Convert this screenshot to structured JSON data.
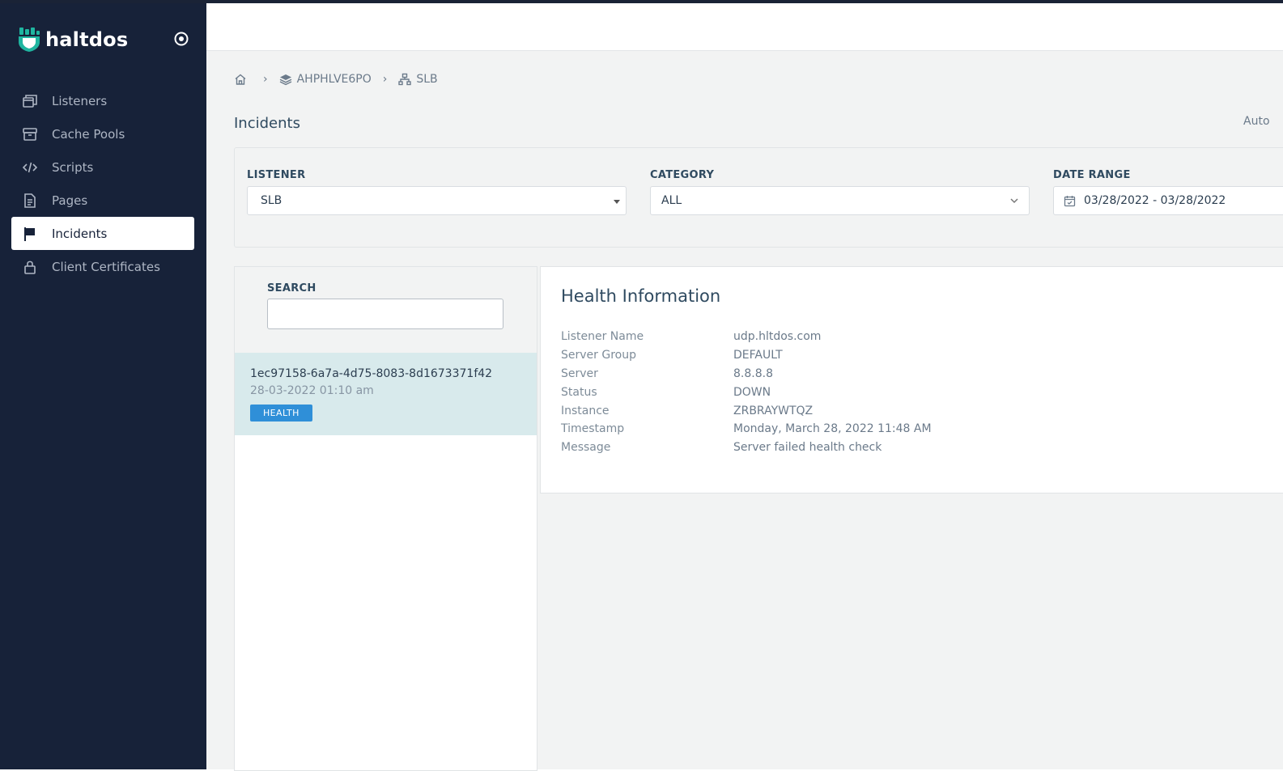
{
  "brand": {
    "name": "haltdos"
  },
  "sidebar": {
    "items": [
      {
        "label": "Listeners",
        "icon": "window-stack-icon",
        "active": false
      },
      {
        "label": "Cache Pools",
        "icon": "archive-box-icon",
        "active": false
      },
      {
        "label": "Scripts",
        "icon": "code-icon",
        "active": false
      },
      {
        "label": "Pages",
        "icon": "document-icon",
        "active": false
      },
      {
        "label": "Incidents",
        "icon": "flag-icon",
        "active": true
      },
      {
        "label": "Client Certificates",
        "icon": "lock-icon",
        "active": false
      }
    ]
  },
  "breadcrumb": {
    "home_icon": "home-icon",
    "items": [
      {
        "label": "AHPHLVE6PO",
        "icon": "layers-icon"
      },
      {
        "label": "SLB",
        "icon": "sitemap-icon"
      }
    ],
    "separator": "›"
  },
  "page": {
    "title": "Incidents",
    "auto_label": "Auto"
  },
  "filters": {
    "listener": {
      "label": "LISTENER",
      "value": "SLB"
    },
    "category": {
      "label": "CATEGORY",
      "value": "ALL"
    },
    "date_range": {
      "label": "DATE RANGE",
      "value": "03/28/2022 - 03/28/2022"
    }
  },
  "search": {
    "label": "SEARCH",
    "value": ""
  },
  "incidents": [
    {
      "id": "1ec97158-6a7a-4d75-8083-8d1673371f42",
      "time": "28-03-2022 01:10 am",
      "badge": "HEALTH"
    }
  ],
  "detail": {
    "title": "Health Information",
    "rows": [
      {
        "key": "Listener Name",
        "value": "udp.hltdos.com"
      },
      {
        "key": "Server Group",
        "value": "DEFAULT"
      },
      {
        "key": "Server",
        "value": "8.8.8.8"
      },
      {
        "key": "Status",
        "value": "DOWN"
      },
      {
        "key": "Instance",
        "value": "ZRBRAYWTQZ"
      },
      {
        "key": "Timestamp",
        "value": "Monday, March 28, 2022 11:48 AM"
      },
      {
        "key": "Message",
        "value": "Server failed health check"
      }
    ]
  },
  "colors": {
    "sidebar_bg": "#172239",
    "brand_accent": "#1fb5a0",
    "badge_bg": "#2f8fd8",
    "selected_row": "#d8eaec"
  }
}
